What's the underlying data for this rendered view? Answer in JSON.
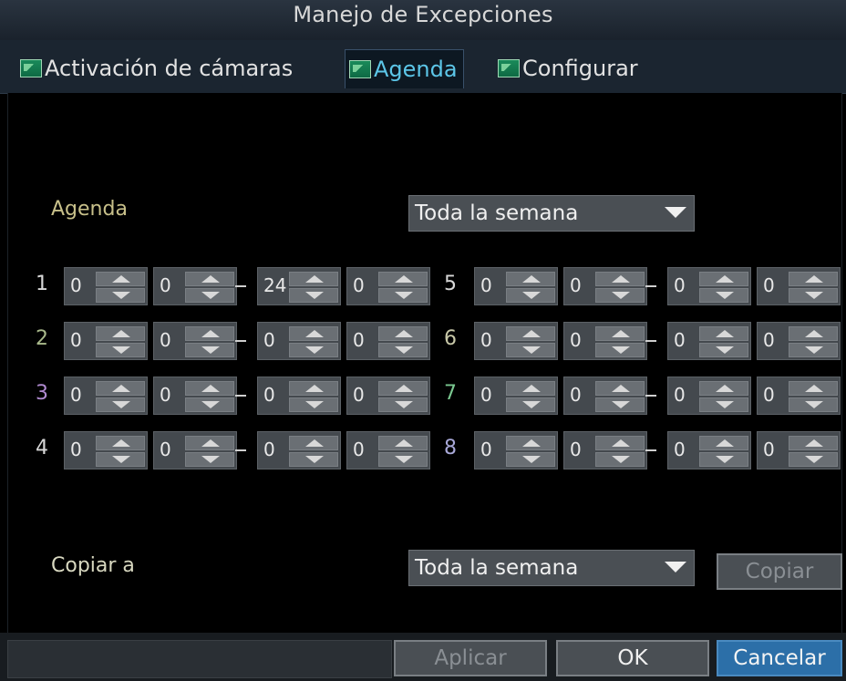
{
  "window": {
    "title": "Manejo de Excepciones"
  },
  "tabs": [
    {
      "label": "Activación de cámaras",
      "active": false,
      "icon": "image-icon"
    },
    {
      "label": "Agenda",
      "active": true,
      "icon": "image-icon"
    },
    {
      "label": "Configurar",
      "active": false,
      "icon": "image-icon"
    }
  ],
  "schedule": {
    "label": "Agenda",
    "selected": "Toda la semana",
    "rows": [
      {
        "num": "1",
        "color": "#d8d8d8",
        "values": [
          "0",
          "0",
          "24",
          "0"
        ]
      },
      {
        "num": "2",
        "color": "#a8b88a",
        "values": [
          "0",
          "0",
          "0",
          "0"
        ]
      },
      {
        "num": "3",
        "color": "#b08ad0",
        "values": [
          "0",
          "0",
          "0",
          "0"
        ]
      },
      {
        "num": "4",
        "color": "#d8d8d8",
        "values": [
          "0",
          "0",
          "0",
          "0"
        ]
      },
      {
        "num": "5",
        "color": "#d8d8d8",
        "values": [
          "0",
          "0",
          "0",
          "0"
        ]
      },
      {
        "num": "6",
        "color": "#c8c8a8",
        "values": [
          "0",
          "0",
          "0",
          "0"
        ]
      },
      {
        "num": "7",
        "color": "#7ac890",
        "values": [
          "0",
          "0",
          "0",
          "0"
        ]
      },
      {
        "num": "8",
        "color": "#a8a8d8",
        "values": [
          "0",
          "0",
          "0",
          "0"
        ]
      }
    ]
  },
  "copy": {
    "label": "Copiar a",
    "selected": "Toda la semana",
    "button": "Copiar"
  },
  "footer": {
    "apply": "Aplicar",
    "ok": "OK",
    "cancel": "Cancelar"
  },
  "colors": {
    "accent": "#5cc6e8",
    "primary_button": "#2c6fa8"
  }
}
